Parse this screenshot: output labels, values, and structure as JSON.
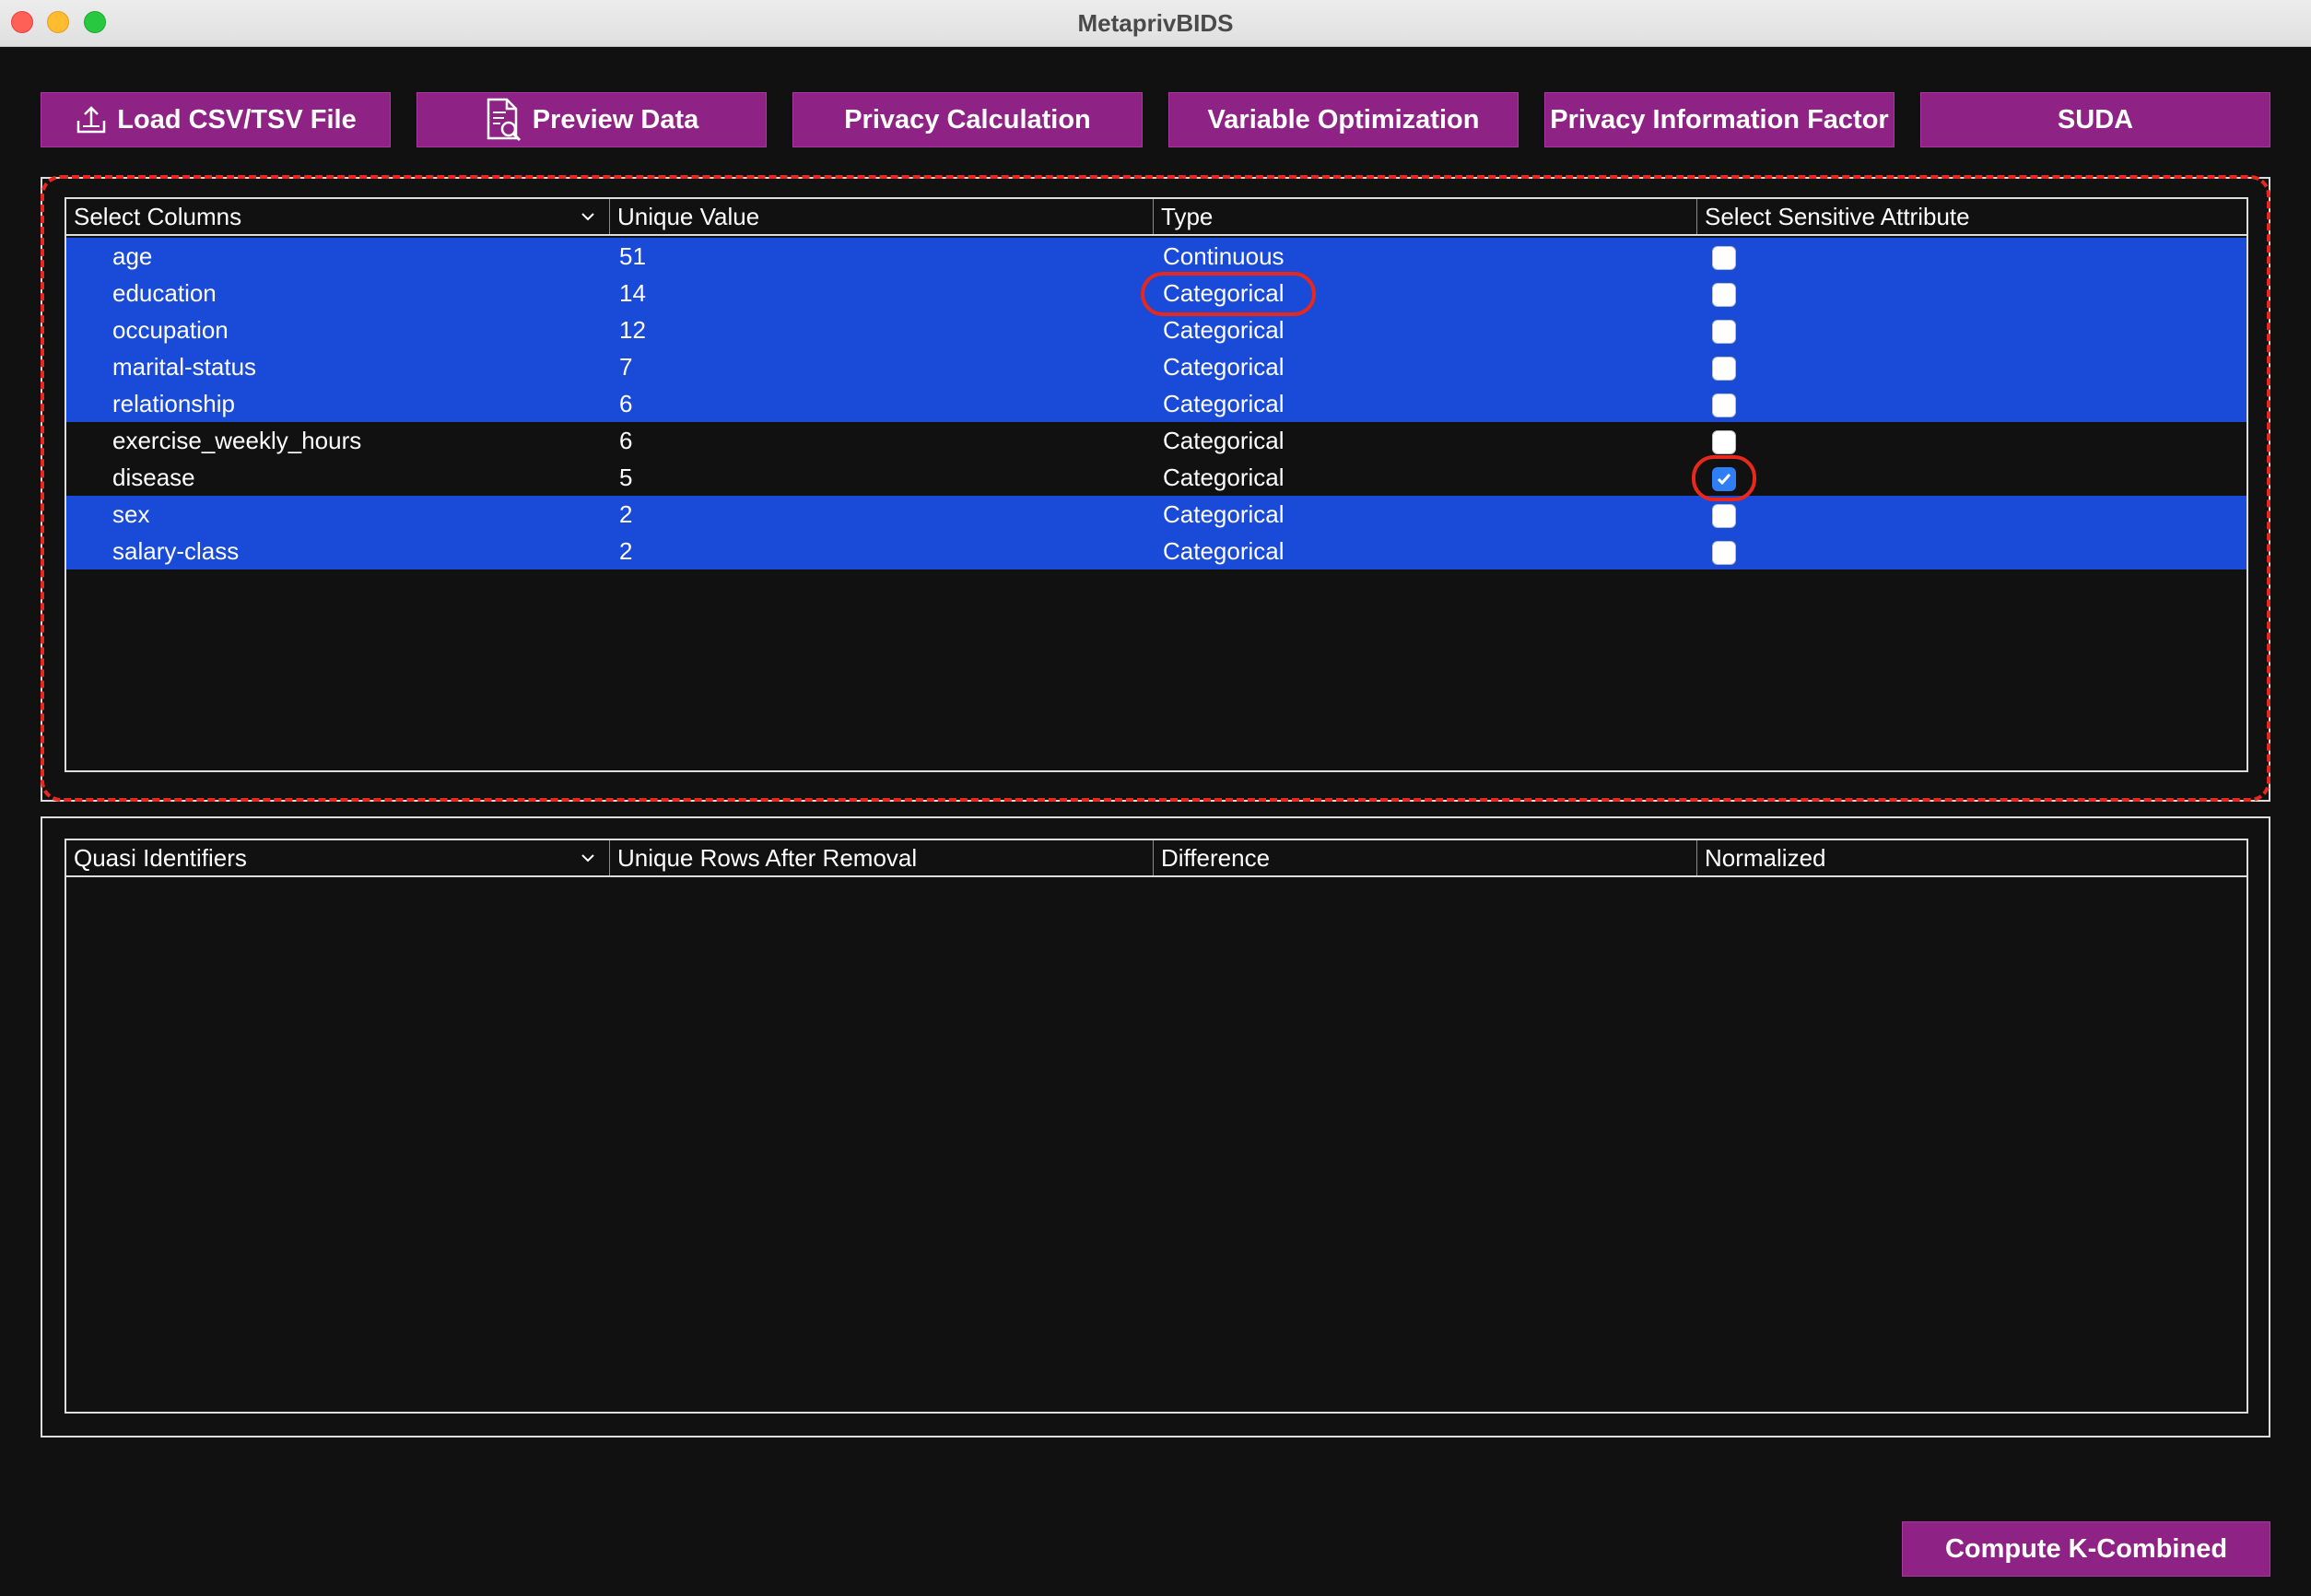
{
  "window": {
    "title": "MetaprivBIDS"
  },
  "toolbar": [
    {
      "label": "Load CSV/TSV File",
      "icon": "upload-icon"
    },
    {
      "label": "Preview Data",
      "icon": "document-search-icon"
    },
    {
      "label": "Privacy Calculation"
    },
    {
      "label": "Variable Optimization"
    },
    {
      "label": "Privacy Information Factor"
    },
    {
      "label": "SUDA"
    }
  ],
  "columns_table": {
    "headers": [
      "Select Columns",
      "Unique Value",
      "Type",
      "Select Sensitive Attribute"
    ],
    "rows": [
      {
        "name": "age",
        "unique": "51",
        "type": "Continuous",
        "selected": true,
        "sensitive": false
      },
      {
        "name": "education",
        "unique": "14",
        "type": "Categorical",
        "selected": true,
        "sensitive": false
      },
      {
        "name": "occupation",
        "unique": "12",
        "type": "Categorical",
        "selected": true,
        "sensitive": false
      },
      {
        "name": "marital-status",
        "unique": "7",
        "type": "Categorical",
        "selected": true,
        "sensitive": false
      },
      {
        "name": "relationship",
        "unique": "6",
        "type": "Categorical",
        "selected": true,
        "sensitive": false
      },
      {
        "name": "exercise_weekly_hours",
        "unique": "6",
        "type": "Categorical",
        "selected": false,
        "sensitive": false
      },
      {
        "name": "disease",
        "unique": "5",
        "type": "Categorical",
        "selected": false,
        "sensitive": true
      },
      {
        "name": "sex",
        "unique": "2",
        "type": "Categorical",
        "selected": true,
        "sensitive": false
      },
      {
        "name": "salary-class",
        "unique": "2",
        "type": "Categorical",
        "selected": true,
        "sensitive": false
      }
    ]
  },
  "qi_table": {
    "headers": [
      "Quasi Identifiers",
      "Unique Rows After Removal",
      "Difference",
      "Normalized"
    ]
  },
  "compute_button": {
    "label": "Compute K-Combined"
  },
  "colors": {
    "accent": "#8e2385",
    "selection": "#1a4ad8",
    "annotation": "#e8281c",
    "background": "#111111"
  }
}
